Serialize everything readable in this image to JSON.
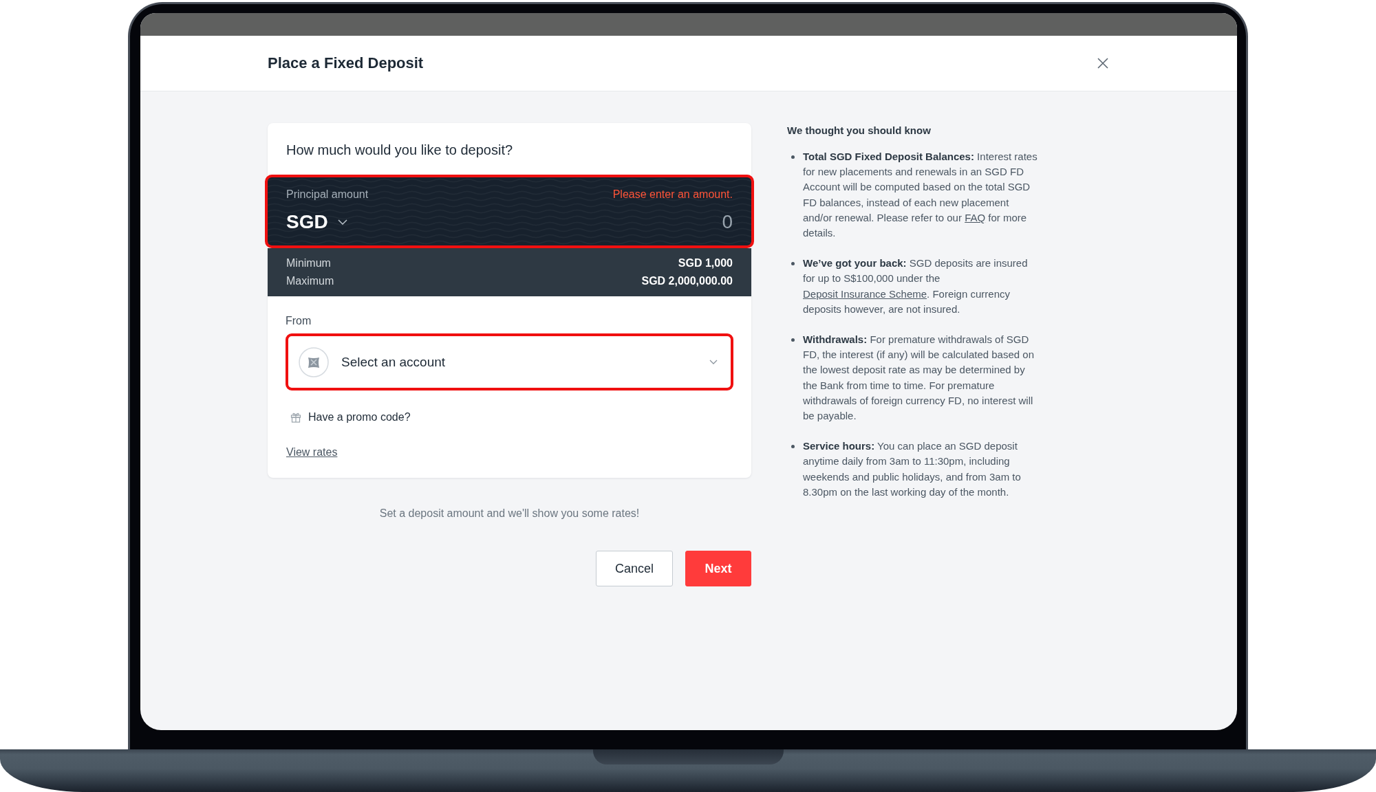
{
  "modal": {
    "title": "Place a Fixed Deposit"
  },
  "deposit_form": {
    "question": "How much would you like to deposit?",
    "principal": {
      "label": "Principal amount",
      "error": "Please enter an amount.",
      "currency": "SGD",
      "placeholder": "0",
      "invalid": true
    },
    "limits": [
      {
        "label": "Minimum",
        "value": "SGD 1,000"
      },
      {
        "label": "Maximum",
        "value": "SGD 2,000,000.00"
      }
    ],
    "source": {
      "label": "From",
      "placeholder": "Select an account",
      "invalid": true
    },
    "promo_link": "Have a promo code?",
    "rates_link": "View rates"
  },
  "rates_hint": "Set a deposit amount and we'll show you some rates!",
  "buttons": [
    {
      "label": "Cancel",
      "kind": "secondary"
    },
    {
      "label": "Next",
      "kind": "primary"
    }
  ],
  "info": {
    "heading": "We thought you should know",
    "items": [
      {
        "segments": [
          {
            "kind": "text",
            "text": "**Total SGD Fixed Deposit Balances:** Interest rates for new placements and renewals in an SGD FD Account will be computed based on the total SGD FD balances, instead of each new placement and/or renewal. Please refer to our "
          },
          {
            "kind": "link",
            "text": "FAQ"
          },
          {
            "kind": "text",
            "text": " for more details."
          }
        ]
      },
      {
        "segments": [
          {
            "kind": "text",
            "text": "**We’ve got your back:** SGD deposits are insured for up to S$100,000 under the "
          },
          {
            "kind": "link",
            "text": "Deposit Insurance Scheme"
          },
          {
            "kind": "text",
            "text": ". Foreign currency deposits however, are not insured."
          }
        ]
      },
      {
        "segments": [
          {
            "kind": "text",
            "text": "**Withdrawals:** For premature withdrawals of SGD FD, the interest (if any) will be calculated based on the lowest deposit rate as may be determined by the Bank from time to time. For premature withdrawals of foreign currency FD, no interest will be payable."
          }
        ]
      },
      {
        "segments": [
          {
            "kind": "text",
            "text": "**Service hours:** You can place an SGD deposit anytime daily from 3am to 11:30pm, including weekends and public holidays, and from 3am to 8.30pm on the last working day of the month."
          }
        ]
      }
    ]
  }
}
